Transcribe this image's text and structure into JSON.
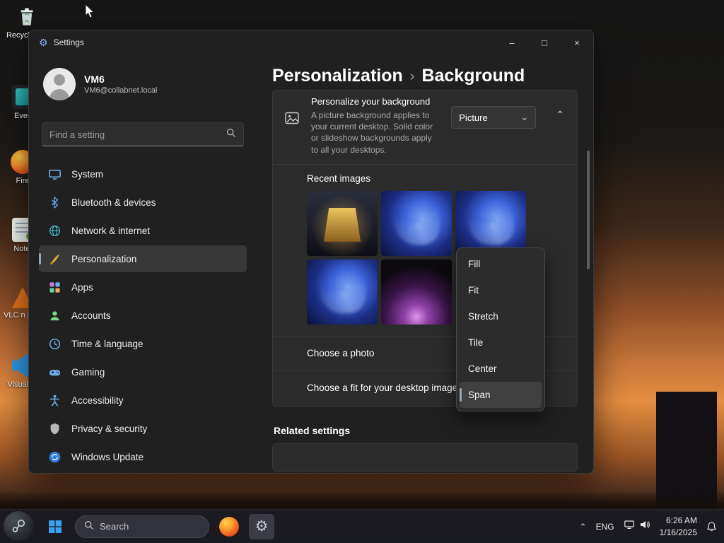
{
  "icons": {
    "gear": "⚙",
    "chevron_down": "⌄",
    "chevron_up": "⌃"
  },
  "desktop": {
    "icons": [
      {
        "label": "Recycle Bin"
      },
      {
        "label": "Every"
      },
      {
        "label": "Fire"
      },
      {
        "label": "Notep"
      },
      {
        "label": "VLC n play"
      },
      {
        "label": "Visual Co"
      }
    ]
  },
  "window": {
    "titlebar": {
      "title": "Settings",
      "minimize": "–",
      "maximize": "□",
      "close": "×"
    },
    "sidebar": {
      "user": {
        "name": "VM6",
        "email": "VM6@collabnet.local"
      },
      "search_placeholder": "Find a setting",
      "items": [
        {
          "label": "System"
        },
        {
          "label": "Bluetooth & devices"
        },
        {
          "label": "Network & internet"
        },
        {
          "label": "Personalization"
        },
        {
          "label": "Apps"
        },
        {
          "label": "Accounts"
        },
        {
          "label": "Time & language"
        },
        {
          "label": "Gaming"
        },
        {
          "label": "Accessibility"
        },
        {
          "label": "Privacy & security"
        },
        {
          "label": "Windows Update"
        }
      ]
    },
    "breadcrumb": {
      "parent": "Personalization",
      "separator": "›",
      "current": "Background"
    },
    "background_section": {
      "title": "Personalize your background",
      "description": "A picture background applies to your current desktop. Solid color or slideshow backgrounds apply to all your desktops.",
      "type_value": "Picture",
      "recent_images_label": "Recent images",
      "choose_photo_label": "Choose a photo",
      "choose_fit_label": "Choose a fit for your desktop image"
    },
    "related_settings_label": "Related settings"
  },
  "fit_menu": {
    "options": [
      "Fill",
      "Fit",
      "Stretch",
      "Tile",
      "Center",
      "Span"
    ],
    "selected": "Span"
  },
  "taskbar": {
    "search_label": "Search",
    "language": "ENG",
    "time": "6:26 AM",
    "date": "1/16/2025"
  }
}
